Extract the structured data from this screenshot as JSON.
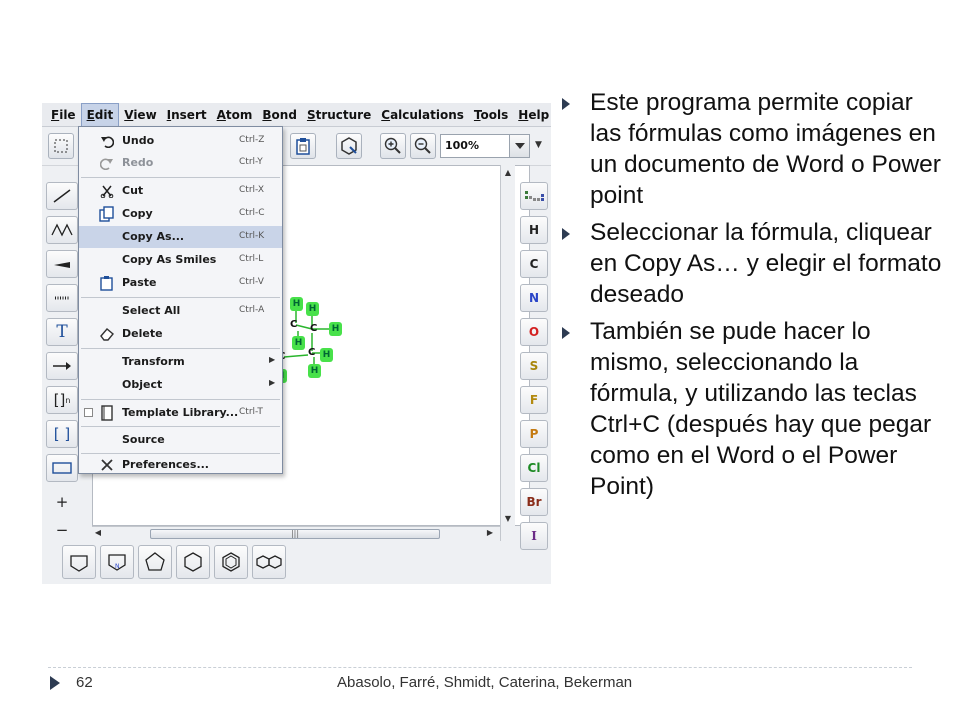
{
  "menubar": {
    "items": [
      {
        "label": "File",
        "u": "F",
        "rest": "ile"
      },
      {
        "label": "Edit",
        "u": "E",
        "rest": "dit"
      },
      {
        "label": "View",
        "u": "V",
        "rest": "iew"
      },
      {
        "label": "Insert",
        "u": "I",
        "rest": "nsert"
      },
      {
        "label": "Atom",
        "u": "A",
        "rest": "tom"
      },
      {
        "label": "Bond",
        "u": "B",
        "rest": "ond"
      },
      {
        "label": "Structure",
        "u": "S",
        "rest": "tructure"
      },
      {
        "label": "Calculations",
        "u": "C",
        "rest": "alculations"
      },
      {
        "label": "Tools",
        "u": "T",
        "rest": "ools"
      },
      {
        "label": "Help",
        "u": "H",
        "rest": "elp"
      }
    ]
  },
  "toolbar": {
    "zoom_value": "100%"
  },
  "edit_menu": {
    "undo": {
      "label": "Undo",
      "accel": "Ctrl-Z"
    },
    "redo": {
      "label": "Redo",
      "accel": "Ctrl-Y"
    },
    "cut": {
      "label": "Cut",
      "accel": "Ctrl-X"
    },
    "copy": {
      "label": "Copy",
      "accel": "Ctrl-C"
    },
    "copy_as": {
      "label": "Copy As...",
      "accel": "Ctrl-K"
    },
    "copy_as_smiles": {
      "label": "Copy As Smiles",
      "accel": "Ctrl-L"
    },
    "paste": {
      "label": "Paste",
      "accel": "Ctrl-V"
    },
    "select_all": {
      "label": "Select All",
      "accel": "Ctrl-A"
    },
    "delete": {
      "label": "Delete"
    },
    "transform": {
      "label": "Transform"
    },
    "object": {
      "label": "Object"
    },
    "template_library": {
      "label": "Template Library...",
      "accel": "Ctrl-T"
    },
    "source": {
      "label": "Source"
    },
    "preferences": {
      "label": "Preferences..."
    }
  },
  "left_tools": {
    "text_tool": "T",
    "bracket_n": "[]",
    "bracket_n_sub": "n",
    "bracket": "[ ]",
    "plus": "+",
    "minus": "−"
  },
  "right_tools": {
    "elements": [
      {
        "symbol": "H",
        "color": "#222222"
      },
      {
        "symbol": "C",
        "color": "#222222"
      },
      {
        "symbol": "N",
        "color": "#2a45c8"
      },
      {
        "symbol": "O",
        "color": "#d42121"
      },
      {
        "symbol": "S",
        "color": "#a8860a"
      },
      {
        "symbol": "F",
        "color": "#b38a10"
      },
      {
        "symbol": "P",
        "color": "#c47a12"
      },
      {
        "symbol": "Cl",
        "color": "#1d8a24"
      },
      {
        "symbol": "Br",
        "color": "#8a2d1a"
      },
      {
        "symbol": "I",
        "color": "#6b2a86"
      }
    ]
  },
  "molecule": {
    "hydrogen": "H",
    "carbon": "C"
  },
  "bullets": [
    "Este programa permite copiar las fórmulas como imágenes en un documento de Word o Power point",
    "Seleccionar la fórmula, cliquear en Copy As… y elegir el formato deseado",
    "También se pude hacer lo mismo, seleccionando la fórmula, y utilizando las teclas Ctrl+C (después hay que pegar como en el Word o el Power Point)"
  ],
  "footer": {
    "page_number": "62",
    "authors": "Abasolo, Farré, Shmidt, Caterina, Bekerman"
  }
}
